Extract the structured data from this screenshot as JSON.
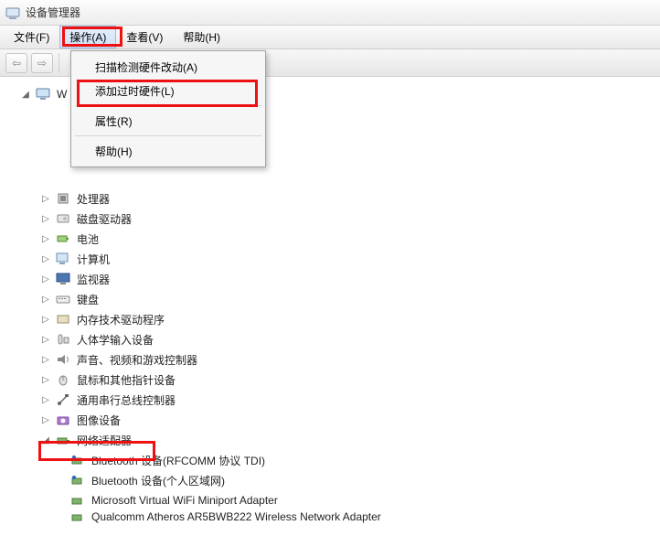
{
  "titlebar": {
    "title": "设备管理器"
  },
  "menubar": {
    "file": "文件(F)",
    "action": "操作(A)",
    "view": "查看(V)",
    "help": "帮助(H)"
  },
  "dropdown": {
    "scan": "扫描检测硬件改动(A)",
    "legacy": "添加过时硬件(L)",
    "properties": "属性(R)",
    "help": "帮助(H)"
  },
  "tree": {
    "root_fragment": "W",
    "nodes": [
      {
        "label": "处理器"
      },
      {
        "label": "磁盘驱动器"
      },
      {
        "label": "电池"
      },
      {
        "label": "计算机"
      },
      {
        "label": "监视器"
      },
      {
        "label": "键盘"
      },
      {
        "label": "内存技术驱动程序"
      },
      {
        "label": "人体学输入设备"
      },
      {
        "label": "声音、视频和游戏控制器"
      },
      {
        "label": "鼠标和其他指针设备"
      },
      {
        "label": "通用串行总线控制器"
      },
      {
        "label": "图像设备"
      },
      {
        "label": "网络适配器"
      }
    ],
    "net_children": [
      {
        "label": "Bluetooth 设备(RFCOMM 协议 TDI)"
      },
      {
        "label": "Bluetooth 设备(个人区域网)"
      },
      {
        "label": "Microsoft Virtual WiFi Miniport Adapter"
      },
      {
        "label": "Qualcomm Atheros AR5BWB222 Wireless Network Adapter"
      }
    ]
  },
  "icons": {
    "cpu": "cpu",
    "disk": "disk",
    "bat": "battery",
    "pc": "pc",
    "mon": "monitor",
    "kb": "keyboard",
    "mem": "chip",
    "hid": "hid",
    "snd": "sound",
    "mouse": "mouse",
    "usb": "usb",
    "img": "camera",
    "net": "net",
    "bt": "bluetooth"
  }
}
